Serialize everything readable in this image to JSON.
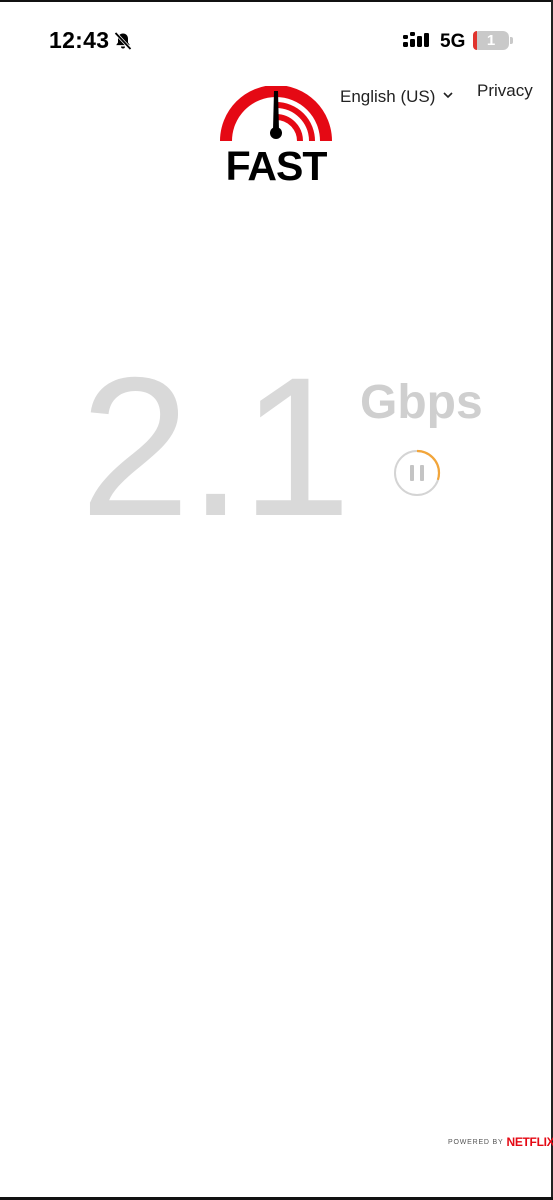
{
  "status_bar": {
    "time": "12:43",
    "network": "5G",
    "battery_level": "1",
    "icons": [
      "bell-slash-icon",
      "signal-icon",
      "battery-icon"
    ]
  },
  "header": {
    "logo_text": "FAST",
    "language": "English (US)",
    "privacy": "Privacy"
  },
  "speed": {
    "value": "2.1",
    "unit": "Gbps",
    "state": "testing",
    "progress": 0.3
  },
  "footer": {
    "powered_by": "POWERED BY",
    "brand": "NETFLIX"
  },
  "colors": {
    "brand_red": "#e50914",
    "speed_gray": "#d9d9d9",
    "spinner_orange": "#f2a53a"
  }
}
